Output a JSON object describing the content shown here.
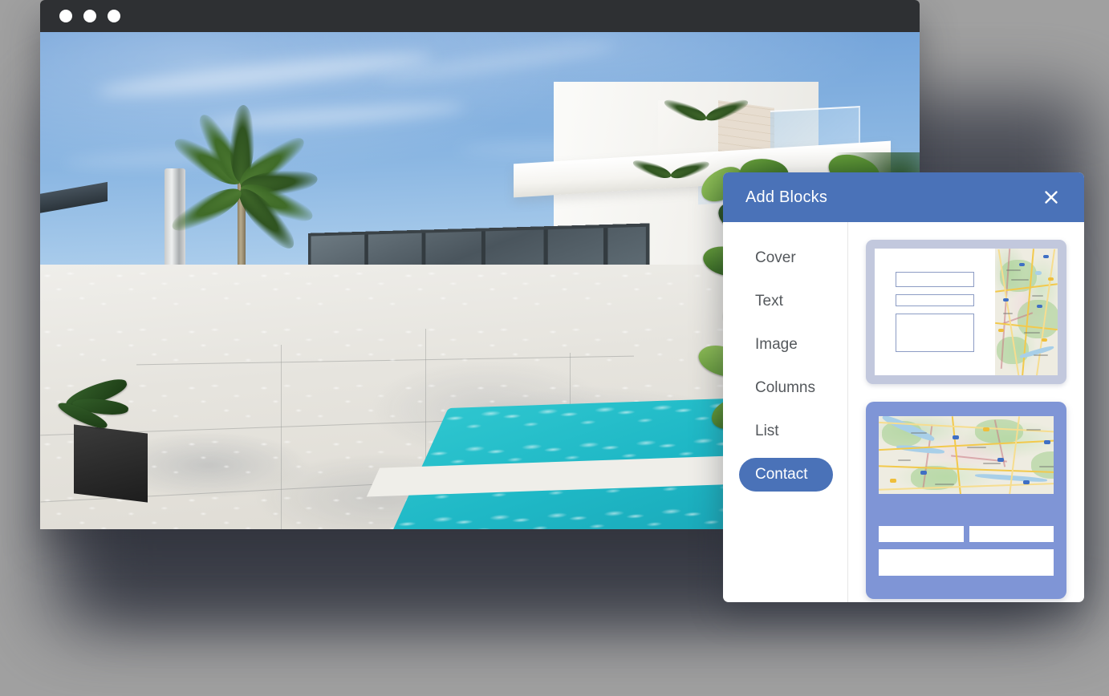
{
  "browser": {
    "window_controls": [
      "dot-1",
      "dot-2",
      "dot-3"
    ],
    "content_description": "modern white villa with swimming pool"
  },
  "modal": {
    "title": "Add Blocks",
    "close_icon": "close-icon",
    "nav": {
      "items": [
        {
          "label": "Cover",
          "active": false
        },
        {
          "label": "Text",
          "active": false
        },
        {
          "label": "Image",
          "active": false
        },
        {
          "label": "Columns",
          "active": false
        },
        {
          "label": "List",
          "active": false
        },
        {
          "label": "Contact",
          "active": true
        }
      ]
    },
    "previews": [
      {
        "name": "contact-layout-light",
        "style": "light-framed",
        "fields": [
          "name-field",
          "email-field",
          "message-field"
        ],
        "map": "map-thumbnail-vertical"
      },
      {
        "name": "contact-layout-blue",
        "style": "blue-card",
        "map": "map-thumbnail-horizontal",
        "fields": [
          "name-field",
          "email-field",
          "message-field"
        ]
      }
    ]
  },
  "colors": {
    "header_blue": "#4a72b8",
    "card_periwinkle": "#7f95d6",
    "card_frame_gray": "#c2c8dd",
    "titlebar_dark": "#2e3033",
    "page_background": "#a0a0a0",
    "nav_text": "#54585c"
  }
}
